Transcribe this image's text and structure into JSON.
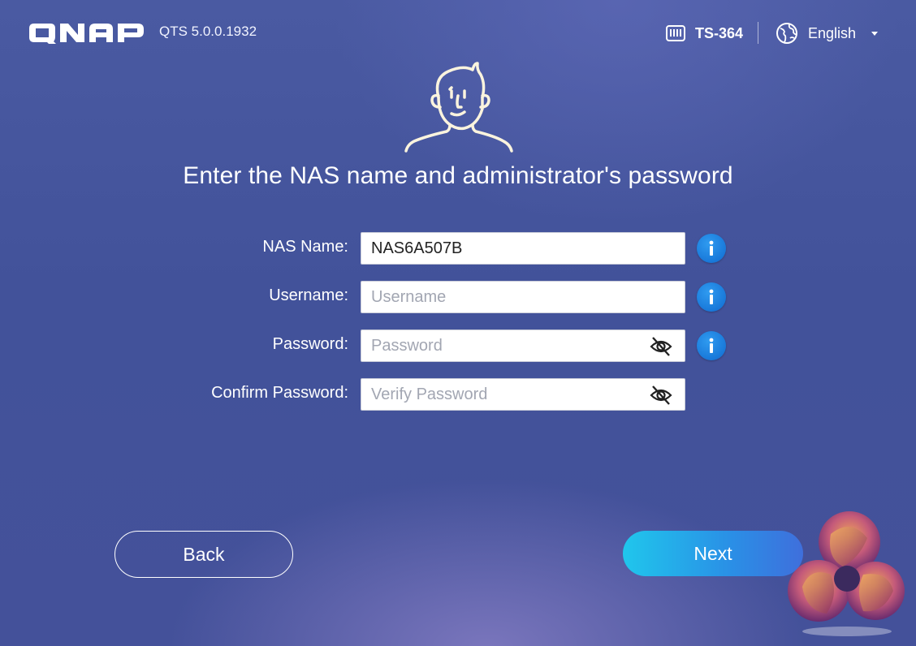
{
  "header": {
    "brand": "QNAP",
    "version": "QTS 5.0.0.1932",
    "model": "TS-364",
    "language": "English",
    "icons": {
      "model": "nas-device-icon",
      "language": "globe-icon",
      "dropdown": "chevron-down-icon"
    }
  },
  "page": {
    "heading": "Enter the NAS name and administrator's password"
  },
  "form": {
    "nas_name": {
      "label": "NAS Name:",
      "value": "NAS6A507B",
      "placeholder": ""
    },
    "username": {
      "label": "Username:",
      "value": "",
      "placeholder": "Username"
    },
    "password": {
      "label": "Password:",
      "value": "",
      "placeholder": "Password"
    },
    "confirm_password": {
      "label": "Confirm Password:",
      "value": "",
      "placeholder": "Verify Password"
    }
  },
  "buttons": {
    "back": "Back",
    "next": "Next"
  },
  "colors": {
    "accent": "#1f8be0",
    "next_gradient_start": "#20c6ec",
    "next_gradient_end": "#3f6fdc",
    "background": "#4a5aa2"
  }
}
